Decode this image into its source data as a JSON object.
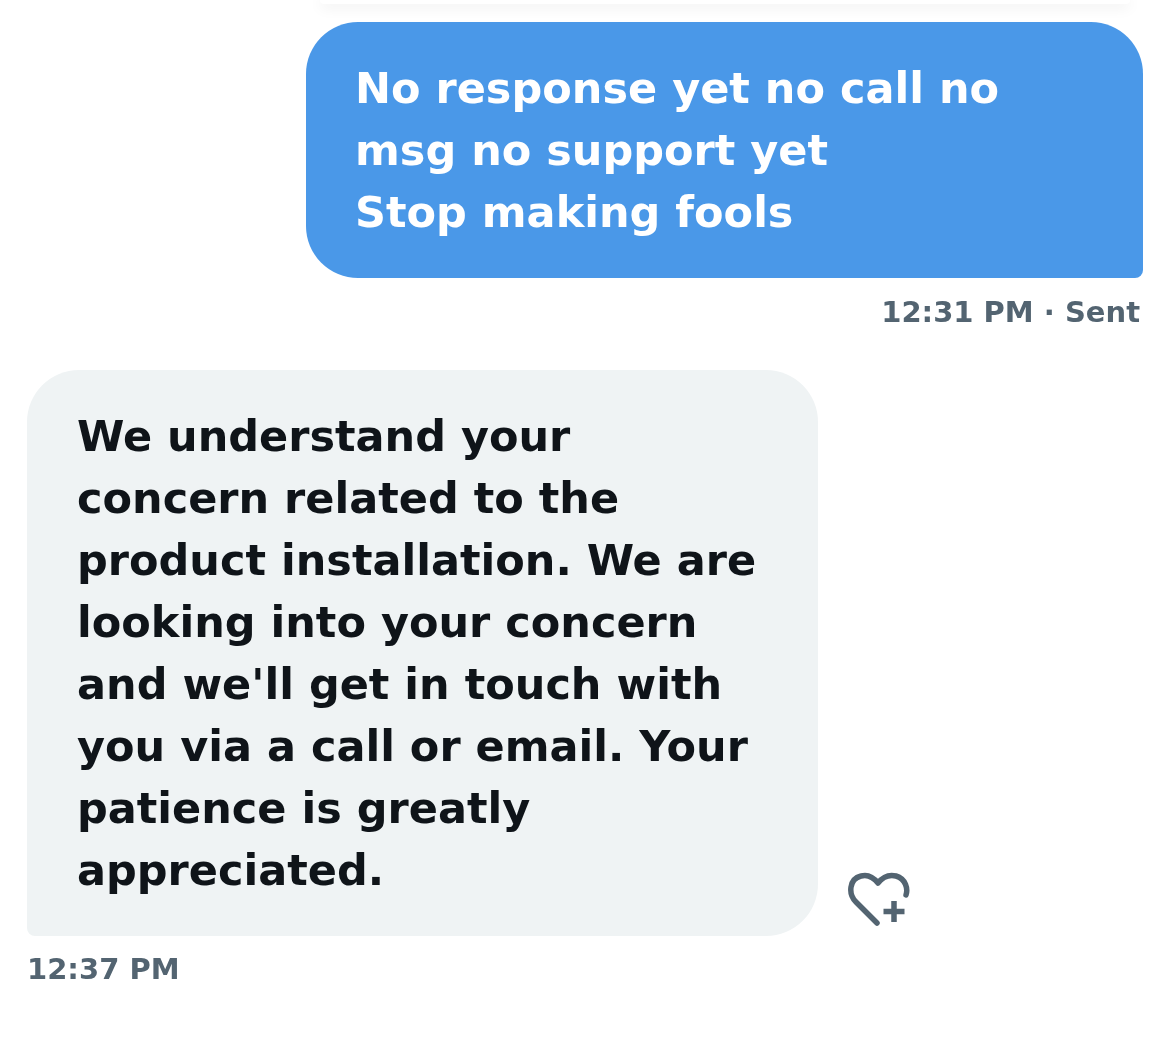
{
  "messages": [
    {
      "kind": "sent",
      "text": "No response yet no call no\nmsg no support yet\nStop making fools",
      "meta": "12:31 PM · Sent"
    },
    {
      "kind": "received",
      "text": "We understand your\nconcern related to the\nproduct installation. We are\nlooking into your concern\nand we'll get in touch with\nyou via a call or email. Your\npatience is greatly\nappreciated.",
      "meta": "12:37 PM",
      "reaction_button": true
    }
  ]
}
